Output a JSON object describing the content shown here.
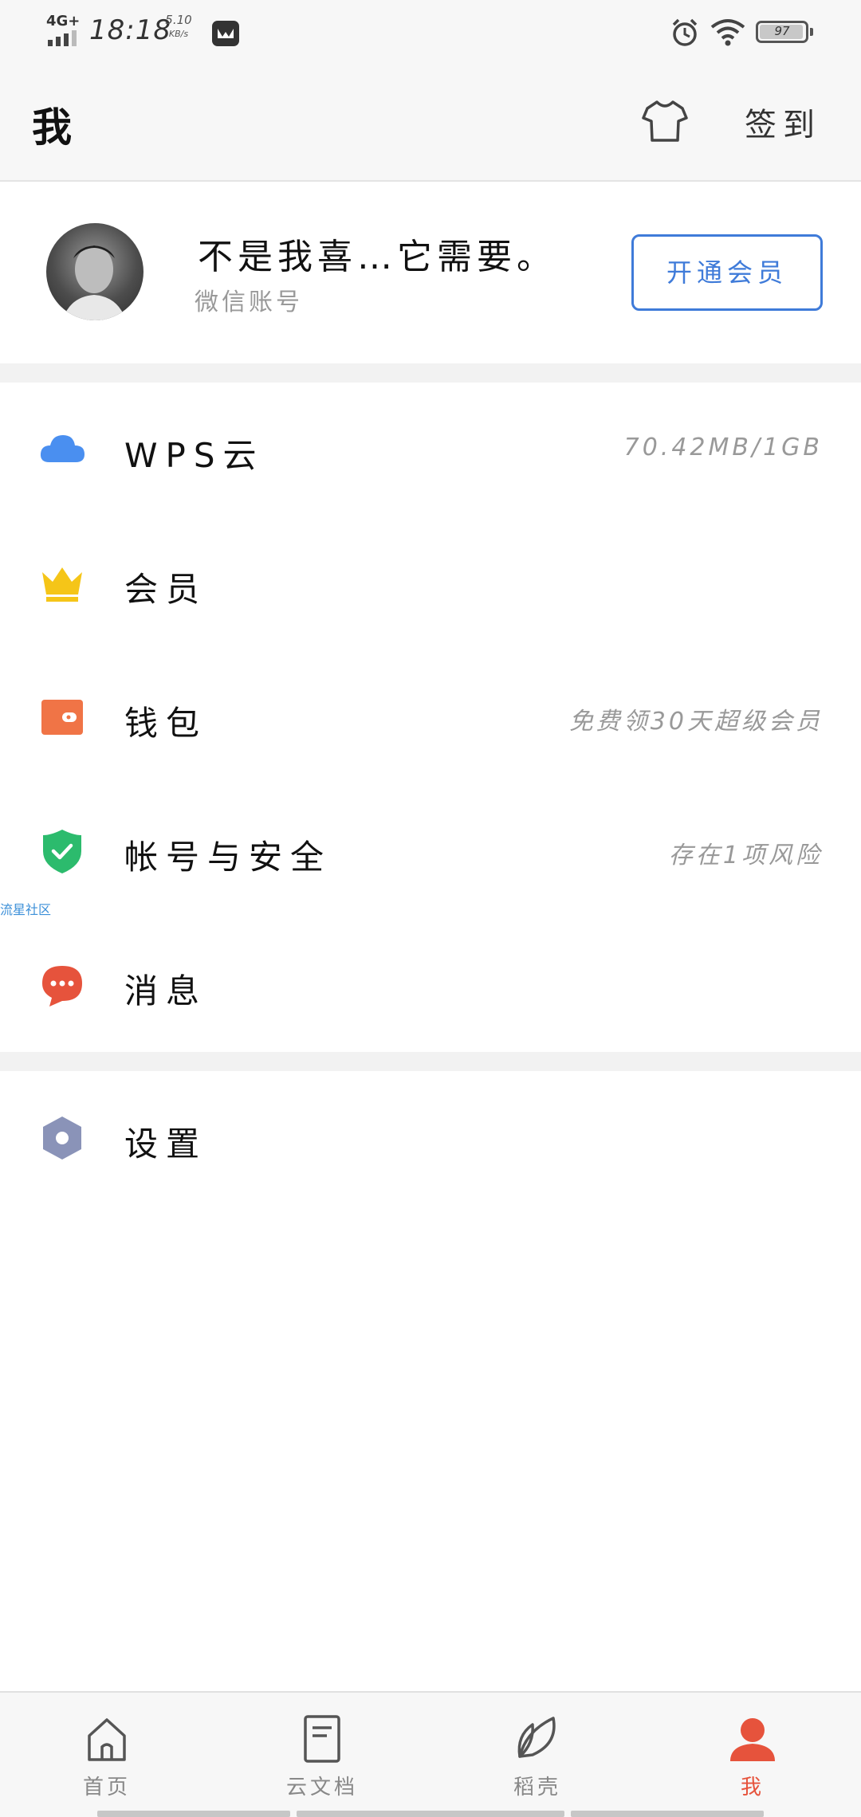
{
  "status_bar": {
    "network": "4G+",
    "time": "18:18",
    "speed_value": "5.10",
    "speed_unit": "KB/s",
    "battery": "97"
  },
  "header": {
    "title": "我",
    "sign_in_label": "签到"
  },
  "profile": {
    "user_name": "不是我喜…它需要。",
    "account_type": "微信账号",
    "vip_button_label": "开通会员"
  },
  "menu": {
    "items": [
      {
        "icon": "cloud-icon",
        "label": "WPS云",
        "value": "70.42MB/1GB",
        "color": "#4a8ff0"
      },
      {
        "icon": "crown-icon",
        "label": "会员",
        "value": "",
        "color": "#f5c518"
      },
      {
        "icon": "wallet-icon",
        "label": "钱包",
        "value": "免费领30天超级会员",
        "color": "#f07446"
      },
      {
        "icon": "shield-icon",
        "label": "帐号与安全",
        "value": "存在1项风险",
        "color": "#2cbb6d"
      },
      {
        "icon": "message-icon",
        "label": "消息",
        "value": "",
        "color": "#e6533c"
      }
    ],
    "settings": {
      "icon": "settings-icon",
      "label": "设置",
      "color": "#8a93b8"
    }
  },
  "watermark": "流星社区",
  "bottom_nav": {
    "items": [
      {
        "icon": "home-icon",
        "label": "首页"
      },
      {
        "icon": "document-icon",
        "label": "云文档"
      },
      {
        "icon": "leaf-icon",
        "label": "稻壳"
      },
      {
        "icon": "person-icon",
        "label": "我",
        "active": true
      }
    ],
    "active_color": "#e6533c"
  }
}
